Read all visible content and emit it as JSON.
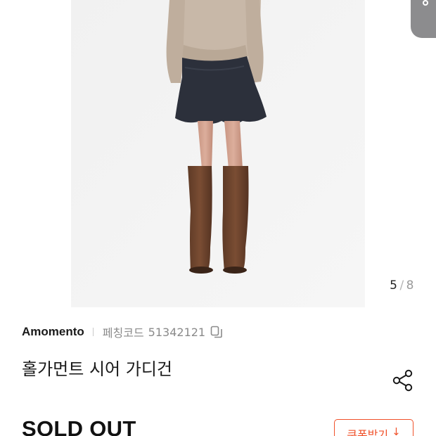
{
  "gallery": {
    "current_index": "5",
    "separator": "/",
    "total_count": "8"
  },
  "product": {
    "brand": "Amomento",
    "code_label": "페칭코드",
    "code_value": "51342121",
    "name": "홀가먼트 시어 가디건"
  },
  "purchase": {
    "status": "SOLD OUT",
    "coupon_label": "쿠폰받기",
    "coupon_arrow": "↓"
  },
  "colors": {
    "accent": "#f0512a",
    "photo_background": "#f3f3f3"
  },
  "icons": {
    "copy": "copy-icon",
    "share": "share-icon",
    "coupon_download": "arrow-down-icon"
  }
}
